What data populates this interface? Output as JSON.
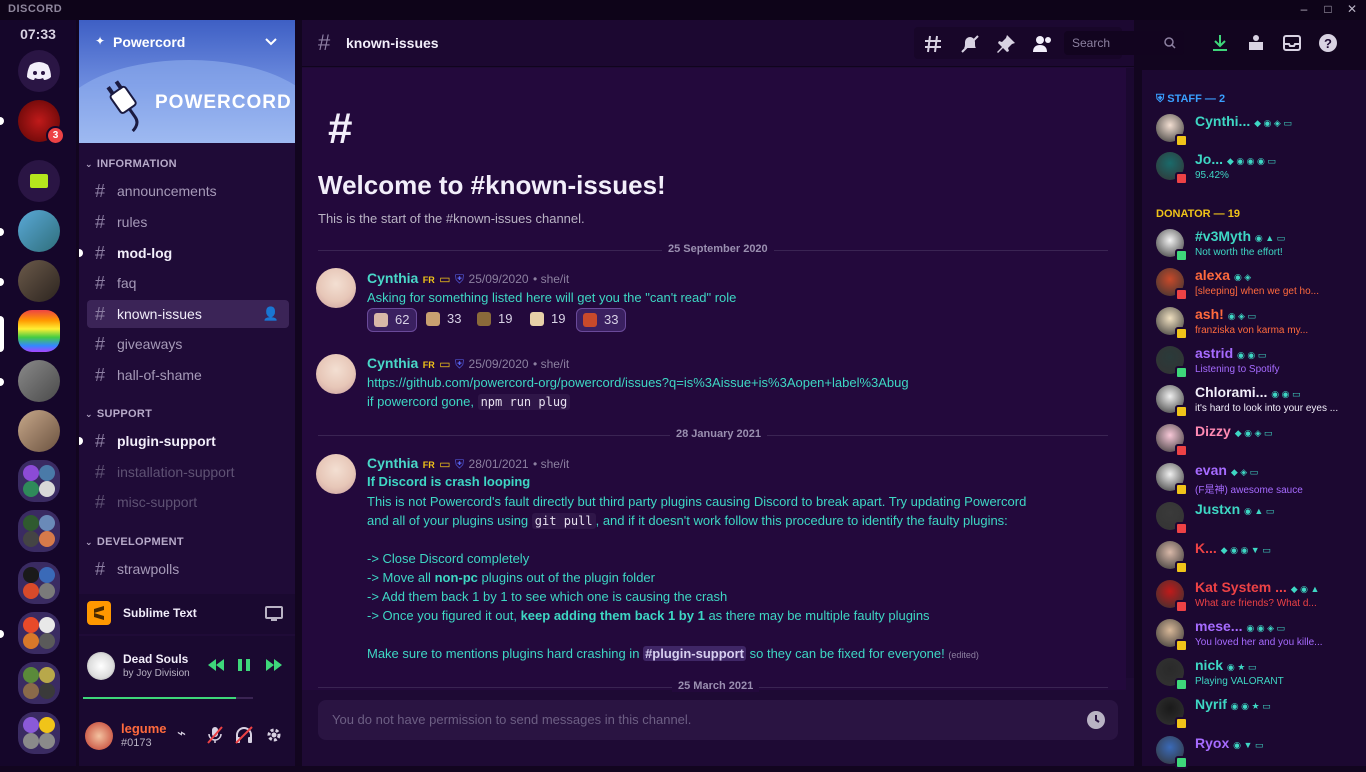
{
  "app": {
    "brand": "DISCORD",
    "clock": "07:33"
  },
  "window_controls": {
    "minimize": "–",
    "maximize": "□",
    "close": "✕"
  },
  "servers": {
    "badge_count": "3"
  },
  "guild": {
    "name": "Powercord",
    "banner_text": "POWERCORD",
    "categories": [
      {
        "label": "INFORMATION"
      },
      {
        "label": "SUPPORT"
      },
      {
        "label": "DEVELOPMENT"
      }
    ],
    "channels": [
      {
        "name": "announcements",
        "state": "normal"
      },
      {
        "name": "rules",
        "state": "normal"
      },
      {
        "name": "mod-log",
        "state": "unread"
      },
      {
        "name": "faq",
        "state": "normal"
      },
      {
        "name": "known-issues",
        "state": "active"
      },
      {
        "name": "giveaways",
        "state": "normal"
      },
      {
        "name": "hall-of-shame",
        "state": "normal"
      },
      {
        "name": "plugin-support",
        "state": "unread"
      },
      {
        "name": "installation-support",
        "state": "muted"
      },
      {
        "name": "misc-support",
        "state": "muted"
      },
      {
        "name": "strawpolls",
        "state": "normal"
      }
    ]
  },
  "activity": {
    "app_name": "Sublime Text"
  },
  "music": {
    "title": "Dead Souls",
    "artist": "by Joy Division",
    "progress": 0.9
  },
  "user": {
    "name": "legume",
    "tag": "#0173"
  },
  "header": {
    "channel": "known-issues",
    "search_placeholder": "Search"
  },
  "welcome": {
    "title": "Welcome to #known-issues!",
    "subtitle": "This is the start of the #known-issues channel."
  },
  "dividers": [
    "25 September 2020",
    "28 January 2021",
    "25 March 2021"
  ],
  "messages": [
    {
      "author": "Cynthia",
      "tag": "FR",
      "timestamp": "25/09/2020",
      "pronouns": "• she/it",
      "text": "Asking for something listed here will get you the \"can't read\" role",
      "reactions": [
        "62",
        "33",
        "19",
        "19",
        "33"
      ]
    },
    {
      "author": "Cynthia",
      "tag": "FR",
      "timestamp": "25/09/2020",
      "pronouns": "• she/it",
      "link": "https://github.com/powercord-org/powercord/issues?q=is%3Aissue+is%3Aopen+label%3Abug",
      "line2_prefix": "if powercord gone,",
      "line2_code": "npm run plug"
    },
    {
      "author": "Cynthia",
      "tag": "FR",
      "timestamp": "28/01/2021",
      "pronouns": "• she/it",
      "heading": "If Discord is crash looping",
      "p1": "This is not Powercord's fault directly but third party plugins causing Discord to break apart. Try updating Powercord",
      "p2_a": "and all of your plugins using",
      "p2_code": "git pull",
      "p2_b": ", and if it doesn't work follow this procedure to identify the faulty plugins:",
      "step1": "-> Close Discord completely",
      "step2_a": "-> Move all",
      "step2_b": "non-pc",
      "step2_c": "plugins out of the plugin folder",
      "step3": "-> Add them back 1 by 1 to see which one is causing the crash",
      "step4_a": "-> Once you figured it out,",
      "step4_b": "keep adding them back 1 by 1",
      "step4_c": "as there may be multiple faulty plugins",
      "p3_a": "Make sure to mentions plugins hard crashing in",
      "p3_mention": "#plugin-support",
      "p3_b": "so they can be fixed for everyone!",
      "edited": "(edited)"
    }
  ],
  "composer": {
    "placeholder": "You do not have permission to send messages in this channel."
  },
  "member_list": {
    "groups": [
      {
        "label": "STAFF — 2",
        "color": "#3aa0ff"
      },
      {
        "label": "DONATOR — 19",
        "color": "#f0c419"
      }
    ],
    "members": [
      {
        "name": "Cynthi...",
        "sub": "",
        "color": "#3ed7c4"
      },
      {
        "name": "Jo...",
        "sub": "95.42%",
        "color": "#3ed7c4"
      },
      {
        "name": "#v3Myth",
        "sub": "Not worth the effort!",
        "color": "#3ed7c4"
      },
      {
        "name": "alexa",
        "sub": "[sleeping] when we get ho...",
        "color": "#ff6a3d"
      },
      {
        "name": "ash!",
        "sub": "franziska von karma my...",
        "color": "#ff6a3d"
      },
      {
        "name": "astrid",
        "sub": "Listening to Spotify",
        "color": "#a66bff"
      },
      {
        "name": "Chlorami...",
        "sub": "it's hard to look into your eyes ...",
        "color": "#f2eefa"
      },
      {
        "name": "Dizzy",
        "sub": "",
        "color": "#ff8ab3"
      },
      {
        "name": "evan",
        "sub": "(F是神) awesome sauce",
        "color": "#a66bff"
      },
      {
        "name": "Justxn",
        "sub": "",
        "color": "#3ed7c4"
      },
      {
        "name": "K...",
        "sub": "",
        "color": "#ed4245"
      },
      {
        "name": "Kat System ...",
        "sub": "What are friends? What d...",
        "color": "#ed4245"
      },
      {
        "name": "mese...",
        "sub": "You loved her and you kille...",
        "color": "#a66bff"
      },
      {
        "name": "nick",
        "sub": "Playing VALORANT",
        "color": "#3ed7c4"
      },
      {
        "name": "Nyrif",
        "sub": "",
        "color": "#3ed7c4"
      },
      {
        "name": "Ryox",
        "sub": "",
        "color": "#a66bff"
      }
    ]
  },
  "colors": {
    "accent": "#3ed7c4",
    "bg": "#12051f",
    "sidebar": "#1f0b37",
    "main": "#23093c",
    "members": "#1c0831"
  },
  "icons": [
    "discord-home-icon",
    "hashtag-icon",
    "threads-icon",
    "mute-icon",
    "pin-icon",
    "members-icon",
    "search-icon",
    "download-icon",
    "inbox-icon",
    "help-icon",
    "settings-icon",
    "add-member-icon"
  ]
}
